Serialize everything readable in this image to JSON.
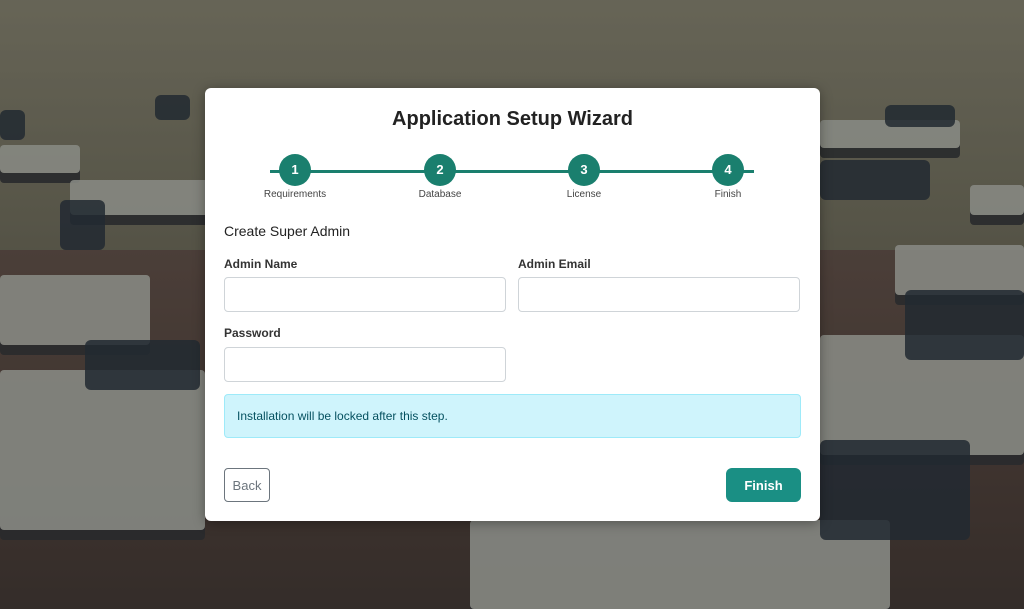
{
  "wizard": {
    "title": "Application Setup Wizard",
    "steps": [
      {
        "number": "1",
        "label": "Requirements"
      },
      {
        "number": "2",
        "label": "Database"
      },
      {
        "number": "3",
        "label": "License"
      },
      {
        "number": "4",
        "label": "Finish"
      }
    ],
    "section_title": "Create Super Admin",
    "fields": {
      "admin_name": {
        "label": "Admin Name",
        "value": ""
      },
      "admin_email": {
        "label": "Admin Email",
        "value": ""
      },
      "password": {
        "label": "Password",
        "value": ""
      }
    },
    "alert_text": "Installation will be locked after this step.",
    "buttons": {
      "back": "Back",
      "finish": "Finish"
    }
  },
  "colors": {
    "accent": "#1a7f6e",
    "finish_button": "#1a8f84",
    "alert_bg": "#cff4fc",
    "alert_text": "#055160"
  }
}
